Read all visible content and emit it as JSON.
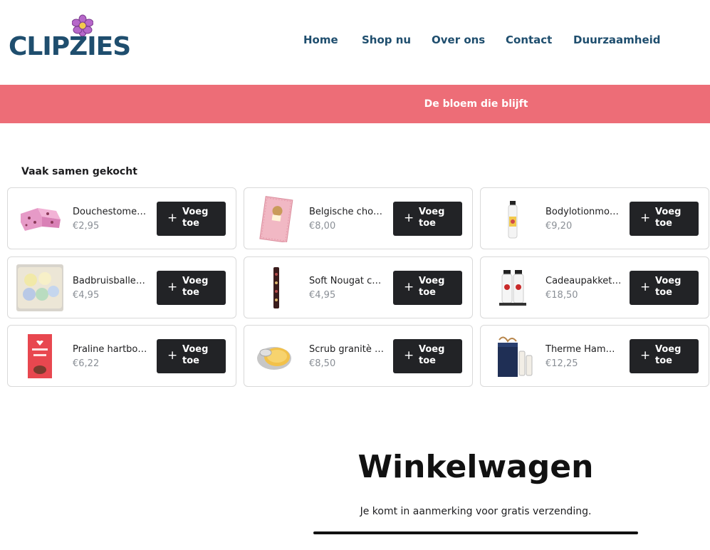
{
  "brand": {
    "logo_text": "CLIPZIES",
    "logo_flower_color": "#b667c9",
    "logo_text_color": "#1f4e6e"
  },
  "nav": {
    "items": [
      {
        "label": "Home"
      },
      {
        "label": "Shop nu"
      },
      {
        "label": "Over ons"
      },
      {
        "label": "Contact"
      },
      {
        "label": "Duurzaamheid"
      }
    ]
  },
  "banner": {
    "text": "De bloem die blijft",
    "color": "#ed6d77"
  },
  "frequently_bought": {
    "title": "Vaak samen gekocht",
    "add_label": "Voeg toe",
    "products": [
      {
        "name": "Douchestomer ...",
        "price": "€2,95",
        "icon": "pink-bath-fizzer"
      },
      {
        "name": "Belgische choc...",
        "price": "€8,00",
        "icon": "chocolate-bar-pink"
      },
      {
        "name": "Bodylotionmou...",
        "price": "€9,20",
        "icon": "lotion-bottle"
      },
      {
        "name": "Badbruisballen...",
        "price": "€4,95",
        "icon": "bath-bombs-box"
      },
      {
        "name": "Soft Nougat ch...",
        "price": "€4,95",
        "icon": "nougat-tube"
      },
      {
        "name": "Cadeaupakket ...",
        "price": "€18,50",
        "icon": "gift-bottles"
      },
      {
        "name": "Praline hartbon...",
        "price": "€6,22",
        "icon": "praline-box"
      },
      {
        "name": "Scrub granitè 2...",
        "price": "€8,50",
        "icon": "scrub-jar"
      },
      {
        "name": "Therme Hamm...",
        "price": "€12,25",
        "icon": "gift-set-box"
      }
    ]
  },
  "cart": {
    "title": "Winkelwagen",
    "message": "Je komt in aanmerking voor gratis verzending."
  }
}
